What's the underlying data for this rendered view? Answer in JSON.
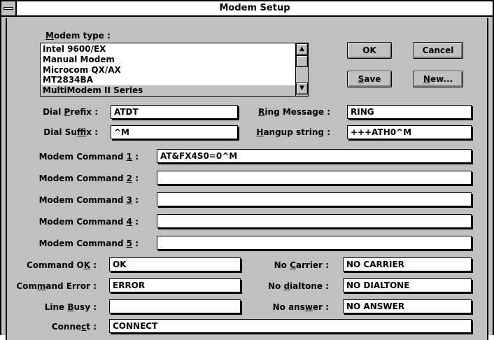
{
  "window": {
    "title": "Modem Setup"
  },
  "modem_type": {
    "label_accel": "M",
    "label_rest": "odem type :",
    "items": [
      "Intel 9600/EX",
      "Manual Modem",
      "Microcom QX/AX",
      "MT2834BA",
      "MultiModem II Series"
    ],
    "selected": "MultiModem II Series"
  },
  "buttons": {
    "ok": "OK",
    "cancel": "Cancel",
    "save_accel": "S",
    "save_rest": "ave",
    "new_accel": "N",
    "new_rest": "ew..."
  },
  "dial_prefix": {
    "pre": "Dial ",
    "accel": "P",
    "post": "refix :",
    "value": "ATDT"
  },
  "dial_suffix": {
    "pre": "Dial Su",
    "accel": "f",
    "post": "fix :",
    "value": "^M"
  },
  "ring_message": {
    "pre": "",
    "accel": "R",
    "post": "ing Message :",
    "value": "RING"
  },
  "hangup_string": {
    "pre": "",
    "accel": "H",
    "post": "angup string :",
    "value": "+++ATH0^M"
  },
  "modem_commands": [
    {
      "pre": "Modem Command ",
      "accel": "1",
      "post": " :",
      "value": "AT&FX4S0=0^M"
    },
    {
      "pre": "Modem Command ",
      "accel": "2",
      "post": " :",
      "value": ""
    },
    {
      "pre": "Modem Command ",
      "accel": "3",
      "post": " :",
      "value": ""
    },
    {
      "pre": "Modem Command ",
      "accel": "4",
      "post": " :",
      "value": ""
    },
    {
      "pre": "Modem Command ",
      "accel": "5",
      "post": " :",
      "value": ""
    }
  ],
  "command_ok": {
    "pre": "Command O",
    "accel": "K",
    "post": " :",
    "value": "OK"
  },
  "command_error": {
    "pre": "Com",
    "accel": "m",
    "post": "and Error :",
    "value": "ERROR"
  },
  "line_busy": {
    "pre": "Line ",
    "accel": "B",
    "post": "usy :",
    "value": ""
  },
  "connect": {
    "pre": "Conne",
    "accel": "c",
    "post": "t :",
    "value": "CONNECT"
  },
  "no_carrier": {
    "pre": "No ",
    "accel": "C",
    "post": "arrier :",
    "value": "NO CARRIER"
  },
  "no_dialtone": {
    "pre": "No ",
    "accel": "d",
    "post": "ialtone :",
    "value": "NO DIALTONE"
  },
  "no_answer": {
    "pre": "No ans",
    "accel": "w",
    "post": "er :",
    "value": "NO ANSWER"
  }
}
